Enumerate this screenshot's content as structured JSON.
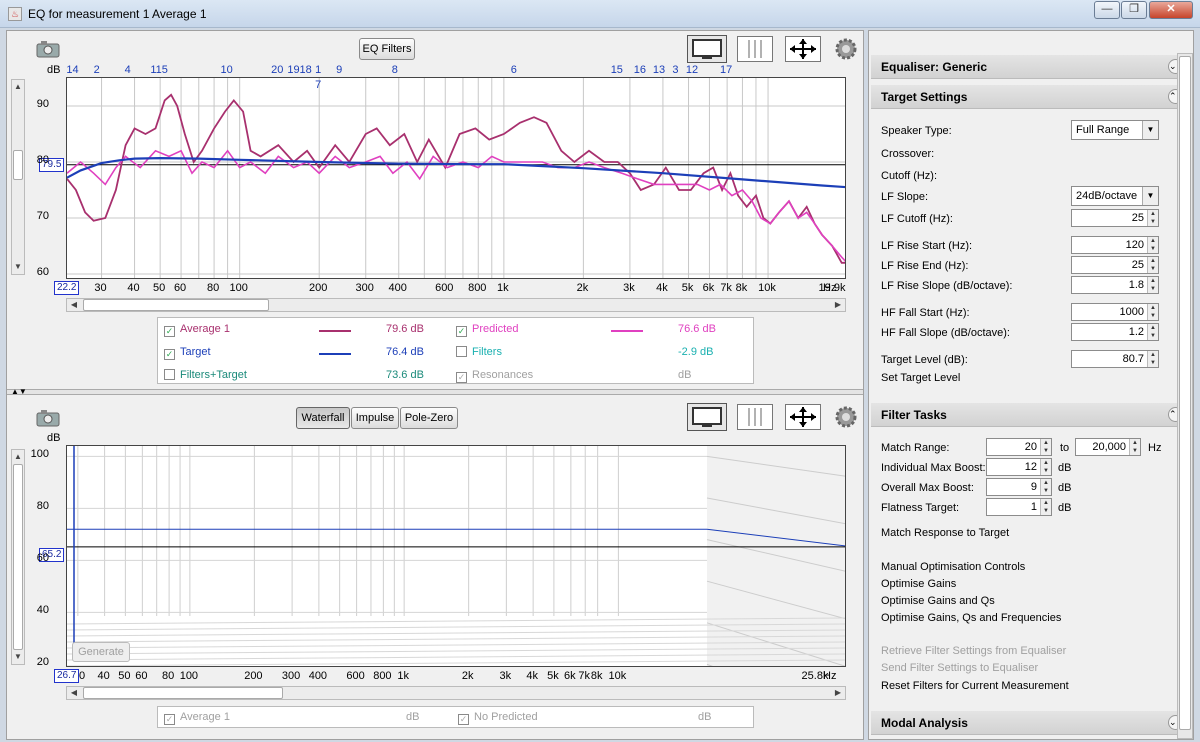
{
  "window": {
    "title": "EQ for measurement 1 Average 1",
    "min": "—",
    "max": "❐",
    "close": "✕"
  },
  "top_graph": {
    "eq_filters_button": "EQ Filters",
    "y_unit": "dB",
    "x_unit": "Hz",
    "y_ticks": [
      "90",
      "80",
      "70",
      "60"
    ],
    "x_ticks": [
      "30",
      "40",
      "50",
      "60",
      "80",
      "100",
      "200",
      "300",
      "400",
      "600",
      "800",
      "1k",
      "2k",
      "3k",
      "4k",
      "5k",
      "6k",
      "7k",
      "8k",
      "10k",
      "19.9k"
    ],
    "x_start_box": "22.2",
    "y_cursor_box": "79.5",
    "filter_numbers": [
      {
        "n": "14",
        "row": 0
      },
      {
        "n": "2",
        "row": 0
      },
      {
        "n": "4",
        "row": 0
      },
      {
        "n": "115",
        "row": 0
      },
      {
        "n": "10",
        "row": 0
      },
      {
        "n": "20",
        "row": 0
      },
      {
        "n": "1918",
        "row": 0
      },
      {
        "n": "1",
        "row": 0
      },
      {
        "n": "7",
        "row": 1
      },
      {
        "n": "9",
        "row": 0
      },
      {
        "n": "8",
        "row": 0
      },
      {
        "n": "6",
        "row": 0
      },
      {
        "n": "15",
        "row": 0
      },
      {
        "n": "16",
        "row": 0
      },
      {
        "n": "13",
        "row": 0
      },
      {
        "n": "3",
        "row": 0
      },
      {
        "n": "12",
        "row": 0
      },
      {
        "n": "17",
        "row": 0
      }
    ],
    "legend": [
      {
        "label": "Average 1",
        "value": "79.6 dB",
        "color": "#a8306e",
        "checked": true
      },
      {
        "label": "Predicted",
        "value": "76.6 dB",
        "color": "#e040c0",
        "checked": true
      },
      {
        "label": "Target",
        "value": "76.4 dB",
        "color": "#1c3fb8",
        "checked": true
      },
      {
        "label": "Filters",
        "value": "-2.9 dB",
        "color": "#1ab0b0",
        "checked": false
      },
      {
        "label": "Filters+Target",
        "value": "73.6 dB",
        "color": "#1a8a7a",
        "checked": false
      },
      {
        "label": "Resonances",
        "value": "dB",
        "color": "#a0a0a0",
        "checked": true,
        "disabled": true
      }
    ]
  },
  "bottom_graph": {
    "tabs": [
      "Waterfall",
      "Impulse",
      "Pole-Zero"
    ],
    "active_tab": "Waterfall",
    "y_unit": "dB",
    "x_unit": "Hz",
    "y_ticks": [
      "100",
      "80",
      "60",
      "40",
      "20"
    ],
    "x_ticks": [
      "40",
      "50",
      "60",
      "80",
      "100",
      "200",
      "300",
      "400",
      "600",
      "800",
      "1k",
      "2k",
      "3k",
      "4k",
      "5k",
      "6k",
      "7k",
      "8k",
      "10k",
      "25.8k"
    ],
    "x_start_box": "26.7",
    "x_start_suffix": "0",
    "y_cursor_box": "65.2",
    "generate_button": "Generate",
    "legend": [
      {
        "label": "Average 1",
        "value": "dB"
      },
      {
        "label": "No Predicted",
        "value": "dB"
      }
    ]
  },
  "right_panel": {
    "equaliser_section": "Equaliser: Generic",
    "target_section": "Target Settings",
    "speaker_type_label": "Speaker Type:",
    "speaker_type_value": "Full Range",
    "crossover_label": "Crossover:",
    "cutoff_label": "Cutoff (Hz):",
    "lf_slope_label": "LF Slope:",
    "lf_slope_value": "24dB/octave",
    "lf_cutoff_label": "LF Cutoff (Hz):",
    "lf_cutoff_value": "25",
    "lf_rise_start_label": "LF Rise Start (Hz):",
    "lf_rise_start_value": "120",
    "lf_rise_end_label": "LF Rise End (Hz):",
    "lf_rise_end_value": "25",
    "lf_rise_slope_label": "LF Rise Slope (dB/octave):",
    "lf_rise_slope_value": "1.8",
    "hf_fall_start_label": "HF Fall Start (Hz):",
    "hf_fall_start_value": "1000",
    "hf_fall_slope_label": "HF Fall Slope (dB/octave):",
    "hf_fall_slope_value": "1.2",
    "target_level_label": "Target Level (dB):",
    "target_level_value": "80.7",
    "set_target_level": "Set Target Level",
    "filter_tasks_section": "Filter Tasks",
    "match_range_label": "Match Range:",
    "match_range_from": "20",
    "match_range_to_label": "to",
    "match_range_to": "20,000",
    "hz_unit": "Hz",
    "indiv_max_boost_label": "Individual Max Boost:",
    "indiv_max_boost_value": "12",
    "overall_max_boost_label": "Overall Max Boost:",
    "overall_max_boost_value": "9",
    "flatness_target_label": "Flatness Target:",
    "flatness_target_value": "1",
    "db_unit": "dB",
    "match_response": "Match Response to Target",
    "manual_opt": "Manual Optimisation Controls",
    "opt_gains": "Optimise Gains",
    "opt_gains_qs": "Optimise Gains and Qs",
    "opt_gains_qs_freq": "Optimise Gains, Qs and Frequencies",
    "retrieve": "Retrieve Filter Settings from Equaliser",
    "send": "Send Filter Settings to Equaliser",
    "reset": "Reset Filters for Current Measurement",
    "modal_section": "Modal Analysis"
  },
  "colors": {
    "measurement": "#a8306e",
    "predicted": "#e040c0",
    "target": "#1c3fb8"
  }
}
